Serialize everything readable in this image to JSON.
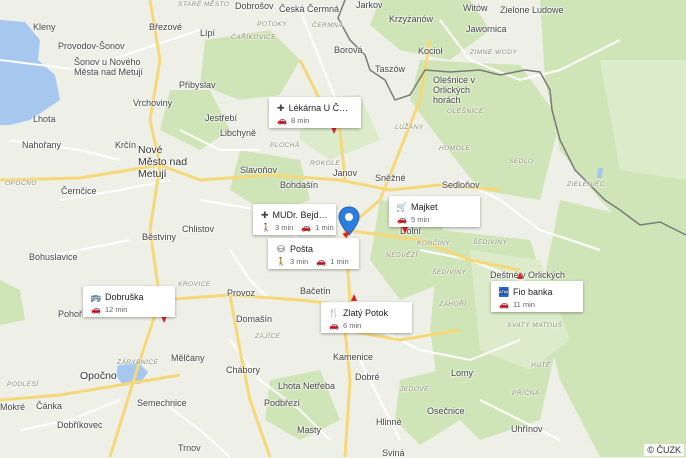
{
  "map": {
    "attribution": "© ČUZK",
    "places": [
      {
        "name": "Dobrošov",
        "cls": ""
      },
      {
        "name": "Česká Čermná",
        "cls": ""
      },
      {
        "name": "Jarkov",
        "cls": ""
      },
      {
        "name": "Witów",
        "cls": ""
      },
      {
        "name": "Zielone Ludowe",
        "cls": ""
      },
      {
        "name": "Kleny",
        "cls": ""
      },
      {
        "name": "Březové",
        "cls": ""
      },
      {
        "name": "Provodov-Šonov",
        "cls": ""
      },
      {
        "name": "Lípí",
        "cls": ""
      },
      {
        "name": "Krzyżanów",
        "cls": ""
      },
      {
        "name": "Jawornica",
        "cls": ""
      },
      {
        "name": "Šonov u Nového Města nad Metují",
        "cls": ""
      },
      {
        "name": "Borová",
        "cls": ""
      },
      {
        "name": "Kocioł",
        "cls": ""
      },
      {
        "name": "Přibyslav",
        "cls": ""
      },
      {
        "name": "Taszów",
        "cls": ""
      },
      {
        "name": "Olešnice v Orlických horách",
        "cls": ""
      },
      {
        "name": "Vrchoviny",
        "cls": ""
      },
      {
        "name": "Lhota",
        "cls": ""
      },
      {
        "name": "Jestřebí",
        "cls": ""
      },
      {
        "name": "Libchyně",
        "cls": ""
      },
      {
        "name": "Nahořany",
        "cls": ""
      },
      {
        "name": "Krčín",
        "cls": ""
      },
      {
        "name": "Nové Město nad Metují",
        "cls": "big"
      },
      {
        "name": "Sněžné",
        "cls": ""
      },
      {
        "name": "Slavoňov",
        "cls": ""
      },
      {
        "name": "Sedloňov",
        "cls": ""
      },
      {
        "name": "Černčice",
        "cls": ""
      },
      {
        "name": "Bohdašín",
        "cls": ""
      },
      {
        "name": "Janov",
        "cls": ""
      },
      {
        "name": "Chlistov",
        "cls": ""
      },
      {
        "name": "Běstviny",
        "cls": ""
      },
      {
        "name": "Bohuslavice",
        "cls": ""
      },
      {
        "name": "Deštné v Orlických",
        "cls": ""
      },
      {
        "name": "Provoz",
        "cls": ""
      },
      {
        "name": "Bačetín",
        "cls": ""
      },
      {
        "name": "Kamenice",
        "cls": ""
      },
      {
        "name": "Pohoří",
        "cls": ""
      },
      {
        "name": "Domašín",
        "cls": ""
      },
      {
        "name": "Mělčany",
        "cls": ""
      },
      {
        "name": "Opočno",
        "cls": "big"
      },
      {
        "name": "Chábory",
        "cls": ""
      },
      {
        "name": "Dobré",
        "cls": ""
      },
      {
        "name": "Lhota Netřeba",
        "cls": ""
      },
      {
        "name": "Lomy",
        "cls": ""
      },
      {
        "name": "Mokré",
        "cls": ""
      },
      {
        "name": "Semechnice",
        "cls": ""
      },
      {
        "name": "Podbřezí",
        "cls": ""
      },
      {
        "name": "Čánka",
        "cls": ""
      },
      {
        "name": "Osečnice",
        "cls": ""
      },
      {
        "name": "Dobříkovec",
        "cls": ""
      },
      {
        "name": "Masty",
        "cls": ""
      },
      {
        "name": "Hlinné",
        "cls": ""
      },
      {
        "name": "Uhřínov",
        "cls": ""
      },
      {
        "name": "Trnov",
        "cls": ""
      },
      {
        "name": "Sviná",
        "cls": ""
      },
      {
        "name": "Dolní",
        "cls": ""
      }
    ],
    "regions": [
      "STARÉ MĚSTO",
      "POTOKY",
      "ČERMNÁ",
      "ZIMNE WODY",
      "ČAŘÍKOVICE",
      "OLEŠNICE",
      "LUŽANY",
      "SEDLO",
      "HOMOLE",
      "ZIELENIEC",
      "PLOCHÁ",
      "ROKOLE",
      "NEDVĚZÍ",
      "KONČINY",
      "ŠEDIVINY",
      "ZÁHOŘÍ",
      "KROVICE",
      "ZÁRYBNICE",
      "PODLESÍ",
      "HUTĚ",
      "SVATÝ MATOUŠ",
      "PŘÍČNÁ",
      "JEDOVÉ",
      "ZAJÍCE",
      "OPOČNO",
      "ŠEDIVINY"
    ]
  },
  "pois": [
    {
      "id": "lekarna",
      "name": "Lékárna U Černém…",
      "icon": "pharmacy-icon",
      "glyph": "✚",
      "times": [
        {
          "mode": "car",
          "value": "8 min"
        }
      ]
    },
    {
      "id": "mudr",
      "name": "MUDr. Bejda Josef",
      "icon": "medical-icon",
      "glyph": "✚",
      "times": [
        {
          "mode": "walk",
          "value": "3 min"
        },
        {
          "mode": "car",
          "value": "1 min"
        }
      ]
    },
    {
      "id": "posta",
      "name": "Pošta",
      "icon": "post-office-icon",
      "glyph": "⛁",
      "times": [
        {
          "mode": "walk",
          "value": "3 min"
        },
        {
          "mode": "car",
          "value": "1 min"
        }
      ]
    },
    {
      "id": "majket",
      "name": "Majket",
      "icon": "shopping-cart-icon",
      "glyph": "🛒",
      "times": [
        {
          "mode": "car",
          "value": "5 min"
        }
      ]
    },
    {
      "id": "dobruska",
      "name": "Dobruška",
      "icon": "bus-icon",
      "glyph": "🚌",
      "times": [
        {
          "mode": "car",
          "value": "12 min"
        }
      ]
    },
    {
      "id": "zlaty",
      "name": "Zlatý Potok",
      "icon": "restaurant-icon",
      "glyph": "🍴",
      "times": [
        {
          "mode": "car",
          "value": "6 min"
        }
      ]
    },
    {
      "id": "fio",
      "name": "Fio banka",
      "icon": "bank-icon",
      "glyph": "🏧",
      "times": [
        {
          "mode": "car",
          "value": "11 min"
        }
      ]
    }
  ]
}
